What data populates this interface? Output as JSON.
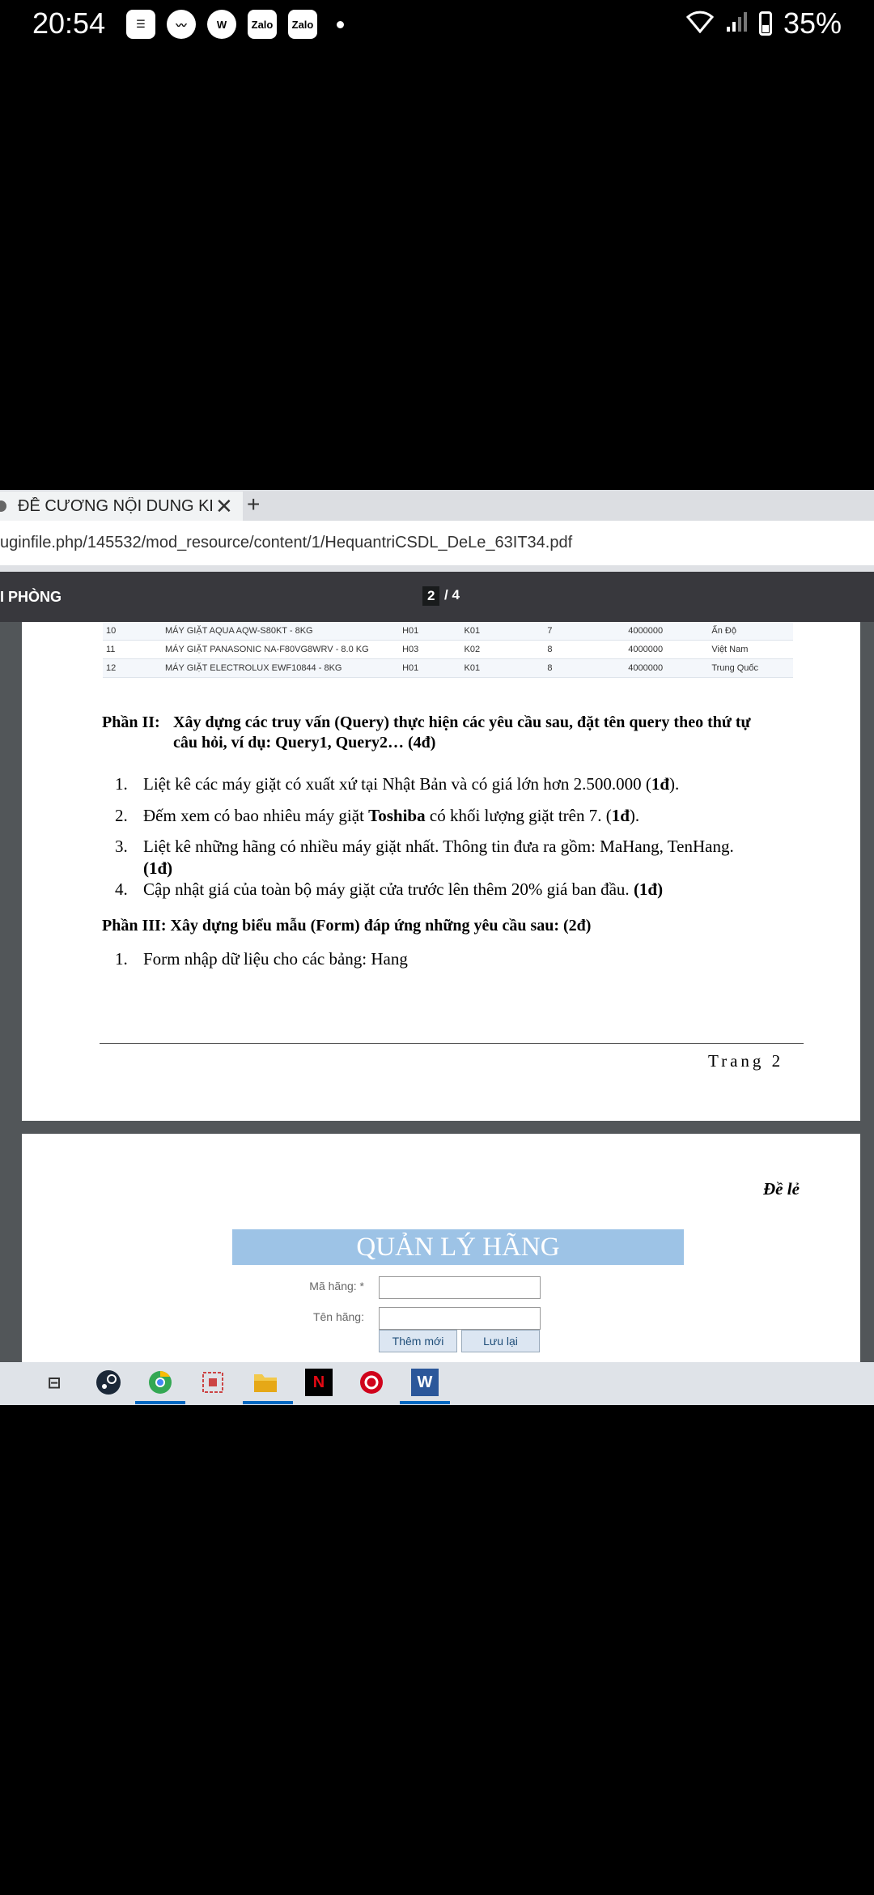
{
  "status_bar": {
    "time": "20:54",
    "icons": [
      "news-icon",
      "messenger-icon",
      "w-icon",
      "zalo",
      "zalo"
    ],
    "zalo_label": "Zalo",
    "battery": "35%"
  },
  "browser": {
    "tab_title": "ĐỀ CƯƠNG NỘI DUNG KHÓA",
    "url": "uginfile.php/145532/mod_resource/content/1/HequantriCSDL_DeLe_63IT34.pdf",
    "viewer_title": "I PHÒNG",
    "page_current": "2",
    "page_total": "/ 4"
  },
  "table_rows": [
    [
      "10",
      "MÁY GIẶT AQUA AQW-S80KT - 8KG",
      "H01",
      "K01",
      "7",
      "4000000",
      "Ấn Độ"
    ],
    [
      "11",
      "MÁY GIẶT PANASONIC NA-F80VG8WRV - 8.0 KG",
      "H03",
      "K02",
      "8",
      "4000000",
      "Việt Nam"
    ],
    [
      "12",
      "MÁY GIẶT ELECTROLUX EWF10844 - 8KG",
      "H01",
      "K01",
      "8",
      "4000000",
      "Trung Quốc"
    ]
  ],
  "part2": {
    "heading": "Phần II:",
    "title_line1": "Xây dựng các truy vấn (Query) thực hiện các yêu cầu sau, đặt tên query theo thứ tự",
    "title_line2": "câu hỏi, ví dụ: Query1, Query2… (4đ)",
    "items": [
      {
        "num": "1.",
        "a": "Liệt kê các máy giặt có xuất xứ tại Nhật Bản và có giá lớn hơn 2.500.000 (",
        "b": "1đ",
        "c": ")."
      },
      {
        "num": "2.",
        "a": "Đếm xem có bao nhiêu máy giặt ",
        "b": "Toshiba",
        "c": " có khối lượng giặt trên 7. (",
        "d": "1đ",
        "e": ")."
      },
      {
        "num": "3.",
        "a": "Liệt kê những hãng có nhiều máy giặt nhất. Thông tin đưa ra gồm: MaHang, TenHang.",
        "b": "(1đ)"
      },
      {
        "num": "4.",
        "a": "Cập nhật giá của toàn bộ máy giặt cửa trước lên thêm 20% giá ban đầu. ",
        "b": "(1đ)"
      }
    ]
  },
  "part3": {
    "heading": "Phần III: Xây dựng biểu mẫu (Form) đáp ứng những yêu cầu sau: (2đ)",
    "items": [
      {
        "num": "1.",
        "text": "Form nhập dữ liệu cho các bảng: Hang"
      }
    ]
  },
  "page_footer": "Trang 2",
  "page2": {
    "header_right": "Đề lẻ",
    "form_title": "QUẢN LÝ HÃNG",
    "label_mahang": "Mã hãng: *",
    "label_tenhang": "Tên hãng:",
    "btn_add": "Thêm mới",
    "btn_save": "Lưu lại"
  },
  "taskbar": [
    "task-view-icon",
    "steam-icon",
    "chrome-icon",
    "snipping-icon",
    "file-explorer-icon",
    "netflix-icon",
    "garena-icon",
    "word-icon"
  ]
}
